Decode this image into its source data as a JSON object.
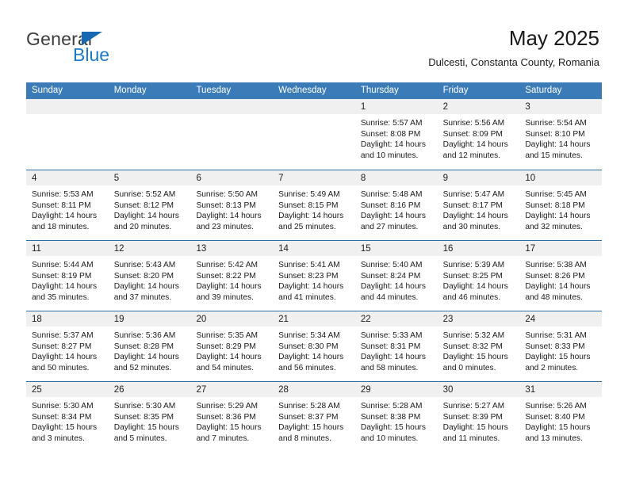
{
  "brand": {
    "name_part1": "General",
    "name_part2": "Blue",
    "logo_icon": "triangle-flag-icon"
  },
  "header": {
    "title": "May 2025",
    "subtitle": "Dulcesti, Constanta County, Romania"
  },
  "colors": {
    "header_blue": "#3b7cb8",
    "rule_blue": "#2e6da4",
    "daynum_band": "#f0f0f0",
    "brand_blue": "#1b79c9",
    "text": "#1a1a1a"
  },
  "weekdays": [
    "Sunday",
    "Monday",
    "Tuesday",
    "Wednesday",
    "Thursday",
    "Friday",
    "Saturday"
  ],
  "weeks": [
    [
      {
        "day": "",
        "sunrise": "",
        "sunset": "",
        "daylight_line1": "",
        "daylight_line2": "",
        "empty": true
      },
      {
        "day": "",
        "sunrise": "",
        "sunset": "",
        "daylight_line1": "",
        "daylight_line2": "",
        "empty": true
      },
      {
        "day": "",
        "sunrise": "",
        "sunset": "",
        "daylight_line1": "",
        "daylight_line2": "",
        "empty": true
      },
      {
        "day": "",
        "sunrise": "",
        "sunset": "",
        "daylight_line1": "",
        "daylight_line2": "",
        "empty": true
      },
      {
        "day": "1",
        "sunrise": "Sunrise: 5:57 AM",
        "sunset": "Sunset: 8:08 PM",
        "daylight_line1": "Daylight: 14 hours",
        "daylight_line2": "and 10 minutes.",
        "empty": false
      },
      {
        "day": "2",
        "sunrise": "Sunrise: 5:56 AM",
        "sunset": "Sunset: 8:09 PM",
        "daylight_line1": "Daylight: 14 hours",
        "daylight_line2": "and 12 minutes.",
        "empty": false
      },
      {
        "day": "3",
        "sunrise": "Sunrise: 5:54 AM",
        "sunset": "Sunset: 8:10 PM",
        "daylight_line1": "Daylight: 14 hours",
        "daylight_line2": "and 15 minutes.",
        "empty": false
      }
    ],
    [
      {
        "day": "4",
        "sunrise": "Sunrise: 5:53 AM",
        "sunset": "Sunset: 8:11 PM",
        "daylight_line1": "Daylight: 14 hours",
        "daylight_line2": "and 18 minutes.",
        "empty": false
      },
      {
        "day": "5",
        "sunrise": "Sunrise: 5:52 AM",
        "sunset": "Sunset: 8:12 PM",
        "daylight_line1": "Daylight: 14 hours",
        "daylight_line2": "and 20 minutes.",
        "empty": false
      },
      {
        "day": "6",
        "sunrise": "Sunrise: 5:50 AM",
        "sunset": "Sunset: 8:13 PM",
        "daylight_line1": "Daylight: 14 hours",
        "daylight_line2": "and 23 minutes.",
        "empty": false
      },
      {
        "day": "7",
        "sunrise": "Sunrise: 5:49 AM",
        "sunset": "Sunset: 8:15 PM",
        "daylight_line1": "Daylight: 14 hours",
        "daylight_line2": "and 25 minutes.",
        "empty": false
      },
      {
        "day": "8",
        "sunrise": "Sunrise: 5:48 AM",
        "sunset": "Sunset: 8:16 PM",
        "daylight_line1": "Daylight: 14 hours",
        "daylight_line2": "and 27 minutes.",
        "empty": false
      },
      {
        "day": "9",
        "sunrise": "Sunrise: 5:47 AM",
        "sunset": "Sunset: 8:17 PM",
        "daylight_line1": "Daylight: 14 hours",
        "daylight_line2": "and 30 minutes.",
        "empty": false
      },
      {
        "day": "10",
        "sunrise": "Sunrise: 5:45 AM",
        "sunset": "Sunset: 8:18 PM",
        "daylight_line1": "Daylight: 14 hours",
        "daylight_line2": "and 32 minutes.",
        "empty": false
      }
    ],
    [
      {
        "day": "11",
        "sunrise": "Sunrise: 5:44 AM",
        "sunset": "Sunset: 8:19 PM",
        "daylight_line1": "Daylight: 14 hours",
        "daylight_line2": "and 35 minutes.",
        "empty": false
      },
      {
        "day": "12",
        "sunrise": "Sunrise: 5:43 AM",
        "sunset": "Sunset: 8:20 PM",
        "daylight_line1": "Daylight: 14 hours",
        "daylight_line2": "and 37 minutes.",
        "empty": false
      },
      {
        "day": "13",
        "sunrise": "Sunrise: 5:42 AM",
        "sunset": "Sunset: 8:22 PM",
        "daylight_line1": "Daylight: 14 hours",
        "daylight_line2": "and 39 minutes.",
        "empty": false
      },
      {
        "day": "14",
        "sunrise": "Sunrise: 5:41 AM",
        "sunset": "Sunset: 8:23 PM",
        "daylight_line1": "Daylight: 14 hours",
        "daylight_line2": "and 41 minutes.",
        "empty": false
      },
      {
        "day": "15",
        "sunrise": "Sunrise: 5:40 AM",
        "sunset": "Sunset: 8:24 PM",
        "daylight_line1": "Daylight: 14 hours",
        "daylight_line2": "and 44 minutes.",
        "empty": false
      },
      {
        "day": "16",
        "sunrise": "Sunrise: 5:39 AM",
        "sunset": "Sunset: 8:25 PM",
        "daylight_line1": "Daylight: 14 hours",
        "daylight_line2": "and 46 minutes.",
        "empty": false
      },
      {
        "day": "17",
        "sunrise": "Sunrise: 5:38 AM",
        "sunset": "Sunset: 8:26 PM",
        "daylight_line1": "Daylight: 14 hours",
        "daylight_line2": "and 48 minutes.",
        "empty": false
      }
    ],
    [
      {
        "day": "18",
        "sunrise": "Sunrise: 5:37 AM",
        "sunset": "Sunset: 8:27 PM",
        "daylight_line1": "Daylight: 14 hours",
        "daylight_line2": "and 50 minutes.",
        "empty": false
      },
      {
        "day": "19",
        "sunrise": "Sunrise: 5:36 AM",
        "sunset": "Sunset: 8:28 PM",
        "daylight_line1": "Daylight: 14 hours",
        "daylight_line2": "and 52 minutes.",
        "empty": false
      },
      {
        "day": "20",
        "sunrise": "Sunrise: 5:35 AM",
        "sunset": "Sunset: 8:29 PM",
        "daylight_line1": "Daylight: 14 hours",
        "daylight_line2": "and 54 minutes.",
        "empty": false
      },
      {
        "day": "21",
        "sunrise": "Sunrise: 5:34 AM",
        "sunset": "Sunset: 8:30 PM",
        "daylight_line1": "Daylight: 14 hours",
        "daylight_line2": "and 56 minutes.",
        "empty": false
      },
      {
        "day": "22",
        "sunrise": "Sunrise: 5:33 AM",
        "sunset": "Sunset: 8:31 PM",
        "daylight_line1": "Daylight: 14 hours",
        "daylight_line2": "and 58 minutes.",
        "empty": false
      },
      {
        "day": "23",
        "sunrise": "Sunrise: 5:32 AM",
        "sunset": "Sunset: 8:32 PM",
        "daylight_line1": "Daylight: 15 hours",
        "daylight_line2": "and 0 minutes.",
        "empty": false
      },
      {
        "day": "24",
        "sunrise": "Sunrise: 5:31 AM",
        "sunset": "Sunset: 8:33 PM",
        "daylight_line1": "Daylight: 15 hours",
        "daylight_line2": "and 2 minutes.",
        "empty": false
      }
    ],
    [
      {
        "day": "25",
        "sunrise": "Sunrise: 5:30 AM",
        "sunset": "Sunset: 8:34 PM",
        "daylight_line1": "Daylight: 15 hours",
        "daylight_line2": "and 3 minutes.",
        "empty": false
      },
      {
        "day": "26",
        "sunrise": "Sunrise: 5:30 AM",
        "sunset": "Sunset: 8:35 PM",
        "daylight_line1": "Daylight: 15 hours",
        "daylight_line2": "and 5 minutes.",
        "empty": false
      },
      {
        "day": "27",
        "sunrise": "Sunrise: 5:29 AM",
        "sunset": "Sunset: 8:36 PM",
        "daylight_line1": "Daylight: 15 hours",
        "daylight_line2": "and 7 minutes.",
        "empty": false
      },
      {
        "day": "28",
        "sunrise": "Sunrise: 5:28 AM",
        "sunset": "Sunset: 8:37 PM",
        "daylight_line1": "Daylight: 15 hours",
        "daylight_line2": "and 8 minutes.",
        "empty": false
      },
      {
        "day": "29",
        "sunrise": "Sunrise: 5:28 AM",
        "sunset": "Sunset: 8:38 PM",
        "daylight_line1": "Daylight: 15 hours",
        "daylight_line2": "and 10 minutes.",
        "empty": false
      },
      {
        "day": "30",
        "sunrise": "Sunrise: 5:27 AM",
        "sunset": "Sunset: 8:39 PM",
        "daylight_line1": "Daylight: 15 hours",
        "daylight_line2": "and 11 minutes.",
        "empty": false
      },
      {
        "day": "31",
        "sunrise": "Sunrise: 5:26 AM",
        "sunset": "Sunset: 8:40 PM",
        "daylight_line1": "Daylight: 15 hours",
        "daylight_line2": "and 13 minutes.",
        "empty": false
      }
    ]
  ]
}
